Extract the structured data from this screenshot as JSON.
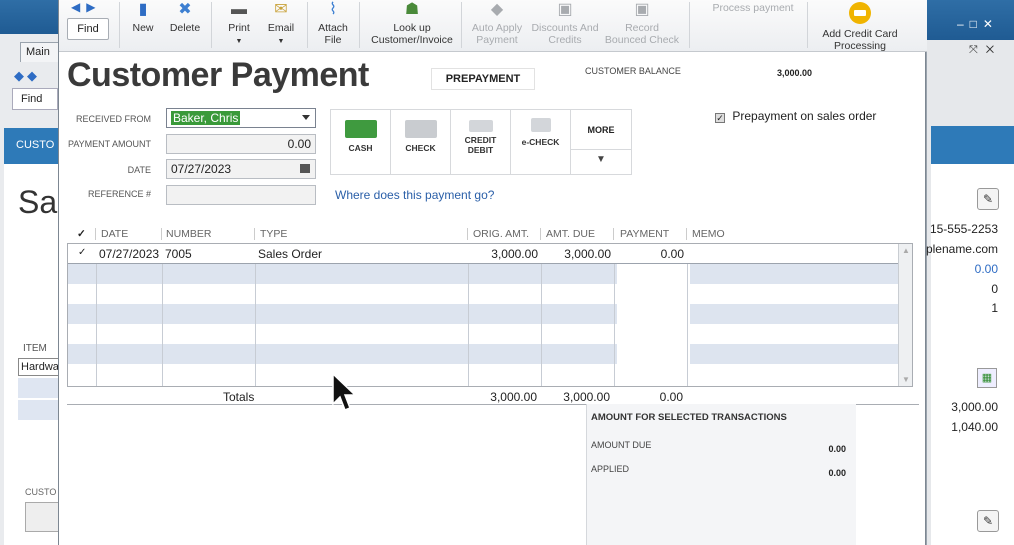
{
  "background_left": {
    "tab_main": "Main",
    "find_label": "Find",
    "header_label": "CUSTO",
    "big_title": "Sa",
    "item_label": "ITEM",
    "item_value": "Hardwa",
    "custo_label": "CUSTO"
  },
  "background_right": {
    "phone": "15-555-2253",
    "email": "plename.com",
    "val1": "0.00",
    "val2": "0",
    "val3": "1",
    "amt1": "3,000.00",
    "amt2": "1,040.00"
  },
  "toolbar": {
    "find": "Find",
    "new": "New",
    "delete": "Delete",
    "print": "Print",
    "email": "Email",
    "attach_line1": "Attach",
    "attach_line2": "File",
    "lookup_line1": "Look up",
    "lookup_line2": "Customer/Invoice",
    "auto_apply_line1": "Auto Apply",
    "auto_apply_line2": "Payment",
    "discounts_line1": "Discounts And",
    "discounts_line2": "Credits",
    "record_line1": "Record",
    "record_line2": "Bounced Check",
    "process_payment": "Process payment",
    "add_cc_line1": "Add Credit Card",
    "add_cc_line2": "Processing"
  },
  "form": {
    "title": "Customer Payment",
    "prepayment_tag": "PREPAYMENT",
    "customer_balance_label": "CUSTOMER BALANCE",
    "customer_balance_value": "3,000.00",
    "received_from_label": "RECEIVED FROM",
    "received_from_value": "Baker, Chris",
    "payment_amount_label": "PAYMENT AMOUNT",
    "payment_amount_value": "0.00",
    "date_label": "DATE",
    "date_value": "07/27/2023",
    "reference_label": "REFERENCE #",
    "reference_value": "",
    "where_link": "Where does this payment go?",
    "prepay_checkbox_label": "Prepayment on sales order"
  },
  "payment_methods": {
    "cash": "CASH",
    "check": "CHECK",
    "credit_line1": "CREDIT",
    "credit_line2": "DEBIT",
    "echeck": "e-CHECK",
    "more": "MORE"
  },
  "table": {
    "headers": {
      "check": "✓",
      "date": "DATE",
      "number": "NUMBER",
      "type": "TYPE",
      "orig_amt": "ORIG. AMT.",
      "amt_due": "AMT. DUE",
      "payment": "PAYMENT",
      "memo": "MEMO"
    },
    "rows": [
      {
        "check": "✓",
        "date": "07/27/2023",
        "number": "7005",
        "type": "Sales Order",
        "orig_amt": "3,000.00",
        "amt_due": "3,000.00",
        "payment": "0.00",
        "memo": ""
      }
    ],
    "totals": {
      "label": "Totals",
      "orig_amt": "3,000.00",
      "amt_due": "3,000.00",
      "payment": "0.00"
    }
  },
  "amount_panel": {
    "header": "AMOUNT FOR SELECTED TRANSACTIONS",
    "amount_due_label": "AMOUNT DUE",
    "amount_due_value": "0.00",
    "applied_label": "APPLIED",
    "applied_value": "0.00"
  },
  "colors": {
    "title_bar": "#1f5b93",
    "accent_band": "#2e7ab8",
    "selection_green": "#3a9a3a",
    "row_stripe": "#dde4ef",
    "link": "#2a5fa8"
  },
  "icons": {
    "nav_back": "arrow-left-icon",
    "nav_forward": "arrow-right-icon",
    "new": "new-document-icon",
    "delete": "delete-x-icon",
    "print": "printer-icon",
    "email": "envelope-icon",
    "attach": "paperclip-icon",
    "lookup": "people-icon",
    "cursor": "mouse-pointer-icon"
  }
}
